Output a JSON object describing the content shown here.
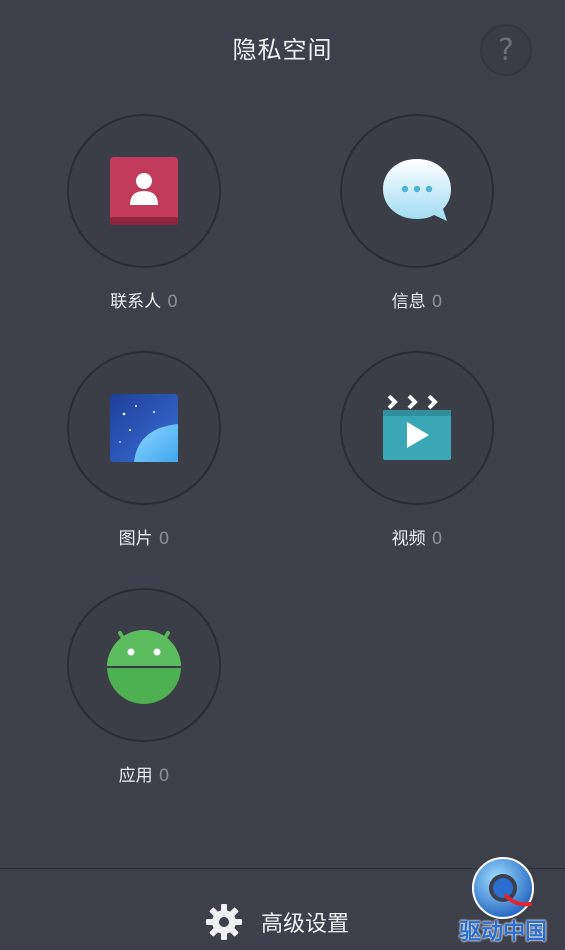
{
  "header": {
    "title": "隐私空间",
    "help_glyph": "?"
  },
  "items": [
    {
      "name": "联系人",
      "count": "0",
      "icon": "contacts-icon",
      "color": "#c23b5a"
    },
    {
      "name": "信息",
      "count": "0",
      "icon": "message-bubble-icon",
      "color": "#7fd4f0"
    },
    {
      "name": "图片",
      "count": "0",
      "icon": "gallery-icon",
      "color": "#2c55b8"
    },
    {
      "name": "视频",
      "count": "0",
      "icon": "video-clapper-icon",
      "color": "#3aa7b4"
    },
    {
      "name": "应用",
      "count": "0",
      "icon": "android-icon",
      "color": "#4caf50"
    }
  ],
  "footer": {
    "settings_label": "高级设置",
    "settings_icon": "gear-icon"
  },
  "watermark": {
    "text": "驱动中国"
  }
}
